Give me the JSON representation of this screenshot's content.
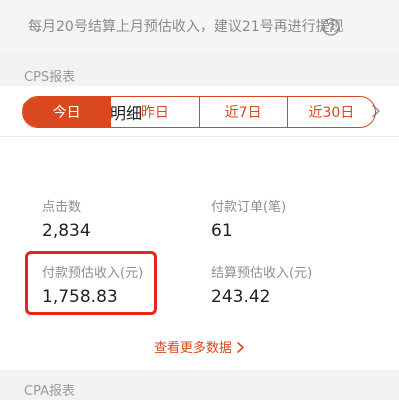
{
  "notice": {
    "text": "每月20号结算上月预估收入，建议21号再进行提现",
    "help_icon": "question-circle-icon"
  },
  "cps_section": {
    "label": "CPS报表",
    "title": "全部订单明细",
    "title_icon": "edit-document-icon",
    "chevron_icon": "chevron-right-icon"
  },
  "date_tabs": [
    {
      "label": "今日",
      "active": true
    },
    {
      "label": "昨日",
      "active": false
    },
    {
      "label": "近7日",
      "active": false
    },
    {
      "label": "近30日",
      "active": false
    }
  ],
  "stats": [
    {
      "label": "点击数",
      "value": "2,834"
    },
    {
      "label": "付款订单(笔)",
      "value": "61"
    },
    {
      "label": "付款预估收入(元)",
      "value": "1,758.83",
      "highlighted": true
    },
    {
      "label": "结算预估收入(元)",
      "value": "243.42"
    }
  ],
  "more_link": {
    "label": "查看更多数据",
    "icon": "chevron-right-icon"
  },
  "cpa_section": {
    "label": "CPA报表"
  },
  "colors": {
    "accent": "#d9481f",
    "highlight_border": "#e8251c",
    "background": "#f2f2f2"
  }
}
